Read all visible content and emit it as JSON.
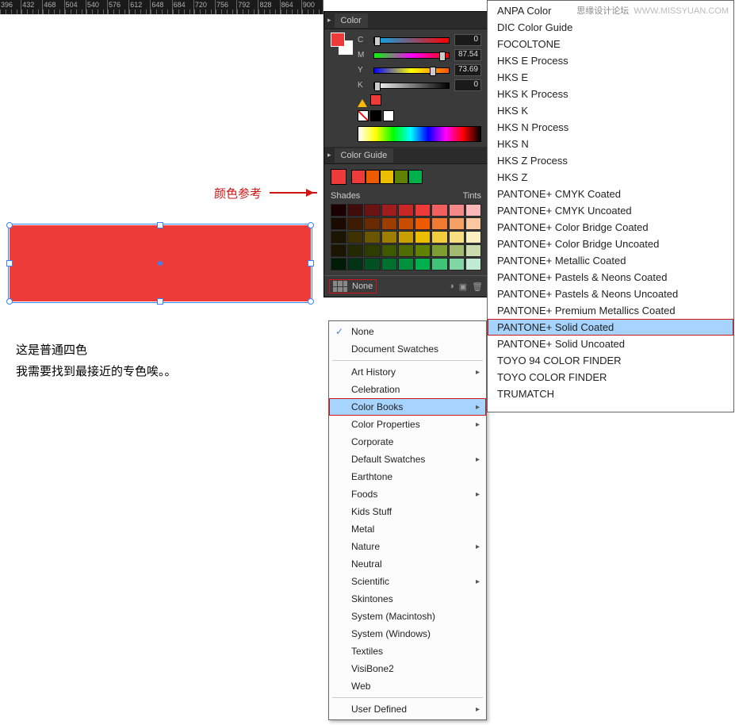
{
  "watermark": {
    "site": "思缘设计论坛",
    "url": "WWW.MISSYUAN.COM"
  },
  "ruler_ticks": [
    "396",
    "432",
    "468",
    "504",
    "540",
    "576",
    "612",
    "648",
    "684",
    "720",
    "756",
    "792",
    "828",
    "864",
    "900"
  ],
  "notes": {
    "color_ref": "颜色参考",
    "body1": "这是普通四色",
    "body2": "我需要找到最接近的专色唉。。"
  },
  "color_panel": {
    "title": "Color",
    "channels": [
      {
        "label": "C",
        "value": "0",
        "grad": [
          "#00aeef",
          "#ff0000"
        ],
        "knob": 0
      },
      {
        "label": "M",
        "value": "87.54",
        "grad": [
          "#00ff00",
          "#ff00ff",
          "#ff0000"
        ],
        "knob": 87
      },
      {
        "label": "Y",
        "value": "73.69",
        "grad": [
          "#0000ff",
          "#ffff00",
          "#ff5500"
        ],
        "knob": 74
      },
      {
        "label": "K",
        "value": "0",
        "grad": [
          "#ffffff",
          "#000000"
        ],
        "knob": 0
      }
    ]
  },
  "guide_panel": {
    "title": "Color Guide",
    "left_label": "Shades",
    "right_label": "Tints",
    "footer_label": "None",
    "swatch_rows": [
      [
        "#1a0000",
        "#400b0b",
        "#6b1313",
        "#a11c1c",
        "#c92727",
        "#ed3b3a",
        "#f15f5e",
        "#f58888",
        "#fab7b7"
      ],
      [
        "#1a0a00",
        "#3e1a00",
        "#6a2a00",
        "#9e3d00",
        "#c94d00",
        "#ed5a00",
        "#f27b33",
        "#f7a066",
        "#fbc7a0"
      ],
      [
        "#1a1500",
        "#3e3300",
        "#6a5600",
        "#9e7e00",
        "#c9a000",
        "#edbd00",
        "#f2cd40",
        "#f7de80",
        "#fbeec0"
      ],
      [
        "#1a1500",
        "#222800",
        "#2d3d00",
        "#3f5900",
        "#4f6d00",
        "#5f8200",
        "#7e9d33",
        "#a2bb70",
        "#cbdbb0"
      ],
      [
        "#001a08",
        "#003315",
        "#005022",
        "#007030",
        "#00903e",
        "#00b04c",
        "#40c278",
        "#80d6a5",
        "#c0ead2"
      ]
    ],
    "harmony_colors": [
      "#ed3b3a",
      "#ed5a00",
      "#edbd00",
      "#5f8200",
      "#00b04c"
    ]
  },
  "menu1": [
    {
      "label": "None",
      "checked": true
    },
    {
      "label": "Document Swatches"
    },
    {
      "sep": true
    },
    {
      "label": "Art History",
      "sub": true
    },
    {
      "label": "Celebration"
    },
    {
      "label": "Color Books",
      "sub": true,
      "hl": true,
      "red": true
    },
    {
      "label": "Color Properties",
      "sub": true
    },
    {
      "label": "Corporate"
    },
    {
      "label": "Default Swatches",
      "sub": true
    },
    {
      "label": "Earthtone"
    },
    {
      "label": "Foods",
      "sub": true
    },
    {
      "label": "Kids Stuff"
    },
    {
      "label": "Metal"
    },
    {
      "label": "Nature",
      "sub": true
    },
    {
      "label": "Neutral"
    },
    {
      "label": "Scientific",
      "sub": true
    },
    {
      "label": "Skintones"
    },
    {
      "label": "System (Macintosh)"
    },
    {
      "label": "System (Windows)"
    },
    {
      "label": "Textiles"
    },
    {
      "label": "VisiBone2"
    },
    {
      "label": "Web"
    },
    {
      "sep": true
    },
    {
      "label": "User Defined",
      "sub": true
    }
  ],
  "menu2": [
    "ANPA Color",
    "DIC Color Guide",
    "FOCOLTONE",
    "HKS E Process",
    "HKS E",
    "HKS K Process",
    "HKS K",
    "HKS N Process",
    "HKS N",
    "HKS Z Process",
    "HKS Z",
    "PANTONE+ CMYK Coated",
    "PANTONE+ CMYK Uncoated",
    "PANTONE+ Color Bridge Coated",
    "PANTONE+ Color Bridge Uncoated",
    "PANTONE+ Metallic Coated",
    "PANTONE+ Pastels & Neons Coated",
    "PANTONE+ Pastels & Neons Uncoated",
    "PANTONE+ Premium Metallics Coated",
    "PANTONE+ Solid Coated",
    "PANTONE+ Solid Uncoated",
    "TOYO 94 COLOR FINDER",
    "TOYO COLOR FINDER",
    "TRUMATCH"
  ],
  "menu2_hl": "PANTONE+ Solid Coated"
}
